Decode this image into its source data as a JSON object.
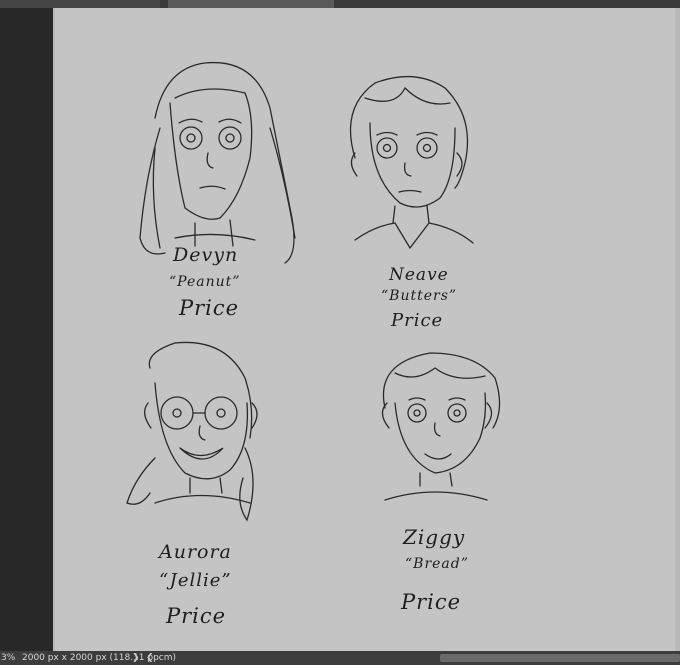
{
  "window": {
    "tabs": [
      {
        "label": ""
      },
      {
        "label": ""
      }
    ]
  },
  "status": {
    "zoom": "3%",
    "doc_info": "2000 px x 2000 px (118.11 ppcm)",
    "next_arrow": "❯",
    "prev_arrow": "❮"
  },
  "characters": [
    {
      "first": "Devyn",
      "nick": "“Peanut”",
      "last": "Price"
    },
    {
      "first": "Neave",
      "nick": "“Butters”",
      "last": "Price"
    },
    {
      "first": "Aurora",
      "nick": "“Jellie”",
      "last": "Price"
    },
    {
      "first": "Ziggy",
      "nick": "“Bread”",
      "last": "Price"
    }
  ],
  "colors": {
    "canvas": "#c4c4c4",
    "ink": "#1e1e1e",
    "chrome": "#2b2b2b"
  }
}
